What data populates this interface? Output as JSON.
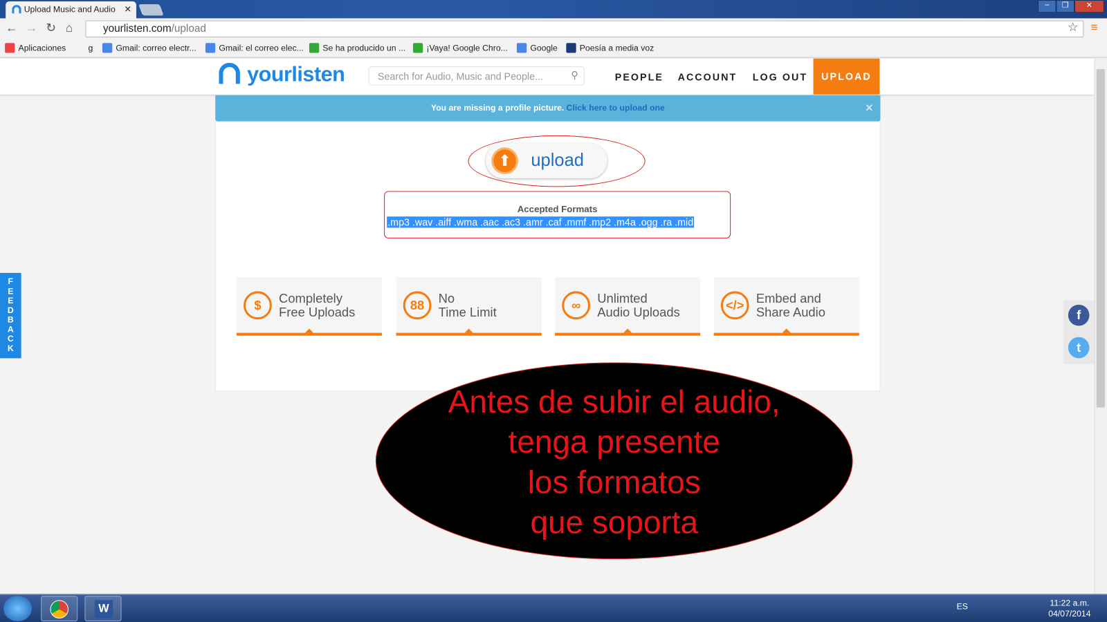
{
  "browser": {
    "tab_title": "Upload Music and Audio",
    "url_host": "yourlisten.com",
    "url_path": "/upload",
    "bookmarks": [
      "Aplicaciones",
      "g",
      "Gmail: correo electr...",
      "Gmail: el correo elec...",
      "Se ha producido un ...",
      "¡Vaya! Google Chro...",
      "Google",
      "Poesía a media voz"
    ]
  },
  "site": {
    "logo": "yourlisten",
    "search_placeholder": "Search for Audio, Music and People...",
    "nav": [
      "PEOPLE",
      "ACCOUNT",
      "LOG OUT",
      "UPLOAD"
    ],
    "alert_text": "You are missing a profile picture.",
    "alert_link": "Click here to upload one",
    "upload_label": "upload",
    "formats_title": "Accepted Formats",
    "formats": ".mp3 .wav .aiff .wma .aac .ac3 .amr .caf .mmf .mp2 .m4a .ogg .ra .mid",
    "features": [
      {
        "l1": "Completely",
        "l2": "Free Uploads",
        "icon": "no-dollar-icon"
      },
      {
        "l1": "No",
        "l2": "Time Limit",
        "icon": "clock-icon"
      },
      {
        "l1": "Unlimted",
        "l2": "Audio Uploads",
        "icon": "infinity-icon"
      },
      {
        "l1": "Embed and",
        "l2": "Share Audio",
        "icon": "code-icon"
      }
    ],
    "feedback": "FEEDBACK"
  },
  "annotation": {
    "lines": [
      "Antes de subir el audio,",
      "tenga presente",
      "los formatos",
      "que soporta"
    ]
  },
  "taskbar": {
    "lang": "ES",
    "time": "11:22 a.m.",
    "date": "04/07/2014"
  }
}
